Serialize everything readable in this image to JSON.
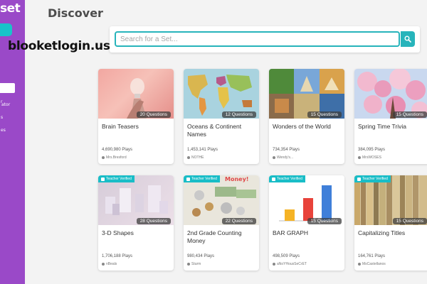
{
  "sidebar": {
    "brand": "set",
    "nav_items": [
      "r",
      "ator",
      "s",
      "es"
    ]
  },
  "watermark": "blooketlogin.us",
  "page_title": "Discover",
  "search": {
    "placeholder": "Search for a Set..."
  },
  "sets": [
    {
      "title": "Brain Teasers",
      "questions": "20 Questions",
      "plays": "4,690,980 Plays",
      "author": "Mrs.Bresford",
      "verified": false
    },
    {
      "title": "Oceans & Continent Names",
      "questions": "12 Questions",
      "plays": "1,453,141 Plays",
      "author": "NOTHE",
      "verified": false
    },
    {
      "title": "Wonders of the World",
      "questions": "15 Questions",
      "plays": "734,354 Plays",
      "author": "Wendy's...",
      "verified": false
    },
    {
      "title": "Spring Time Trivia",
      "questions": "15 Questions",
      "plays": "384,095 Plays",
      "author": "MrsWOSES",
      "verified": false
    },
    {
      "title": "3-D Shapes",
      "questions": "28 Questions",
      "plays": "1,706,188 Plays",
      "author": "nBeals",
      "verified": true
    },
    {
      "title": "2nd Grade Counting Money",
      "questions": "22 Questions",
      "plays": "980,434 Plays",
      "author": "Sturm",
      "verified": true
    },
    {
      "title": "BAR GRAPH",
      "questions": "15 Questions",
      "plays": "498,509 Plays",
      "author": "aNoYHousSeCrET",
      "verified": true
    },
    {
      "title": "Capitalizing Titles",
      "questions": "15 Questions",
      "plays": "164,761 Plays",
      "author": "MsCastellanos",
      "verified": true
    }
  ],
  "labels": {
    "verified": "Teacher Verified",
    "money_banner": "Money!"
  },
  "colors": {
    "sidebar": "#9a49c8",
    "accent": "#27b4bb"
  }
}
